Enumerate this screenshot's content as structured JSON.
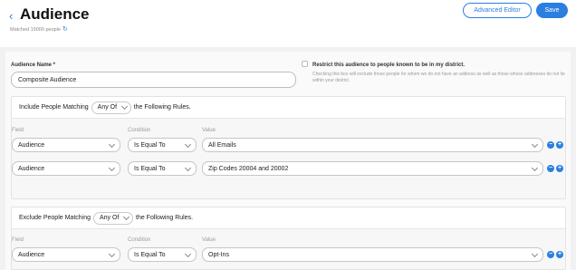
{
  "header": {
    "back_icon": "‹",
    "title": "Audience",
    "matched_text": "Matched 19000 people",
    "refresh_icon": "↻",
    "advanced_editor_label": "Advanced Editor",
    "save_label": "Save"
  },
  "form": {
    "name_label": "Audience Name *",
    "name_value": "Composite Audience",
    "restrict_title": "Restrict this audience to people known to be in my district.",
    "restrict_desc": "Checking this box will exclude those people for whom we do not have an address as well as those whose addresses do not lie within your district.",
    "restrict_checked": false
  },
  "include": {
    "prefix": "Include People Matching",
    "match_value": "Any Of",
    "suffix": "the Following Rules.",
    "columns": {
      "field": "Field",
      "condition": "Condition",
      "value": "Value"
    },
    "rules": [
      {
        "field": "Audience",
        "condition": "Is Equal To",
        "value": "All Emails"
      },
      {
        "field": "Audience",
        "condition": "Is Equal To",
        "value": "Zip Codes 20004 and 20002"
      }
    ]
  },
  "exclude": {
    "prefix": "Exclude People Matching",
    "match_value": "Any Of",
    "suffix": "the Following Rules.",
    "columns": {
      "field": "Field",
      "condition": "Condition",
      "value": "Value"
    },
    "rules": [
      {
        "field": "Audience",
        "condition": "Is Equal To",
        "value": "Opt-Ins"
      }
    ]
  },
  "icons": {
    "minus": "−",
    "plus": "+"
  },
  "colors": {
    "accent": "#2a7fe0"
  }
}
